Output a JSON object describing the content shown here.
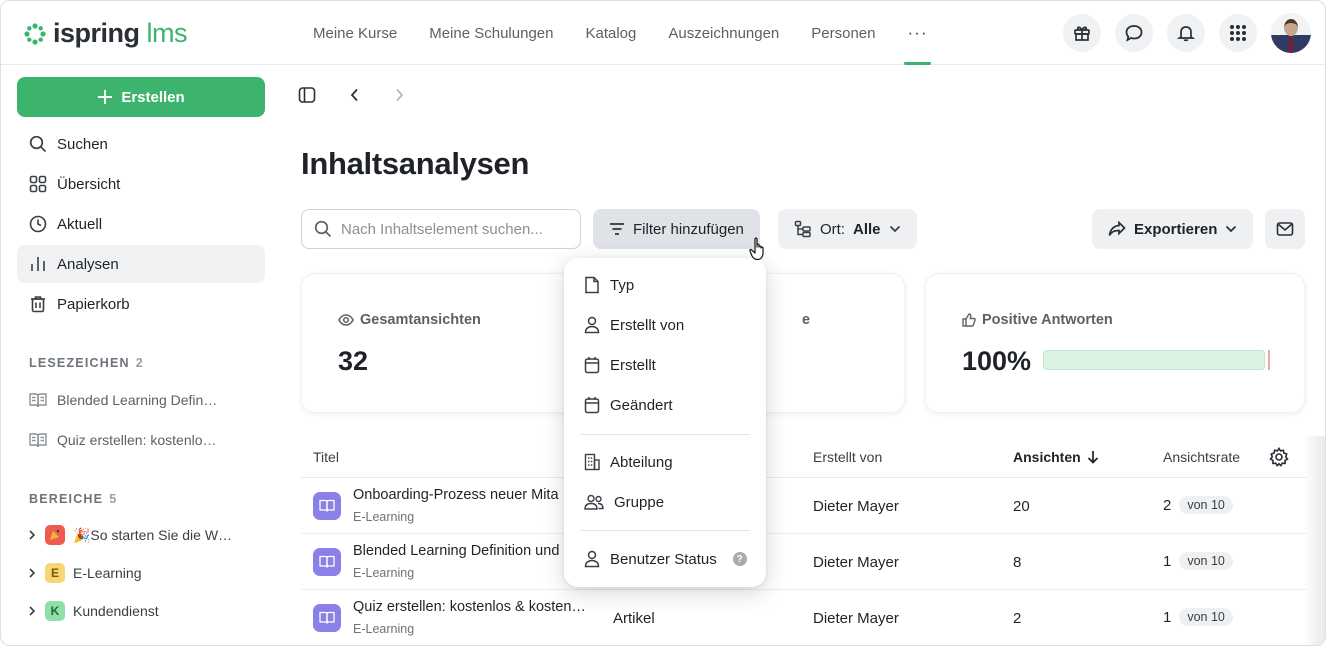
{
  "app": {
    "logo_main": "ispring",
    "logo_sub": "lms",
    "brand_color": "#3db46d"
  },
  "nav": {
    "items": [
      {
        "label": "Meine Kurse"
      },
      {
        "label": "Meine Schulungen"
      },
      {
        "label": "Katalog"
      },
      {
        "label": "Auszeichnungen"
      },
      {
        "label": "Personen"
      }
    ],
    "more": "···"
  },
  "sidebar": {
    "create_label": "Erstellen",
    "items": [
      {
        "label": "Suchen",
        "icon": "search-icon"
      },
      {
        "label": "Übersicht",
        "icon": "grid-icon"
      },
      {
        "label": "Aktuell",
        "icon": "clock-icon"
      },
      {
        "label": "Analysen",
        "icon": "chart-icon",
        "active": true
      },
      {
        "label": "Papierkorb",
        "icon": "trash-icon"
      }
    ],
    "bookmarks_title": "LESEZEICHEN",
    "bookmarks_count": "2",
    "bookmarks": [
      {
        "label": "Blended Learning Defin…"
      },
      {
        "label": "Quiz erstellen: kostenlo…"
      }
    ],
    "areas_title": "BEREICHE",
    "areas_count": "5",
    "areas": [
      {
        "badge": "",
        "label": "🎉So starten Sie die W…",
        "color": "#ef5b4e"
      },
      {
        "badge": "E",
        "label": "E-Learning",
        "color": "#f7d774"
      },
      {
        "badge": "K",
        "label": "Kundendienst",
        "color": "#8fe0a8"
      }
    ]
  },
  "main": {
    "title": "Inhaltsanalysen",
    "search_placeholder": "Nach Inhaltselement suchen...",
    "filter_label": "Filter hinzufügen",
    "location_label": "Ort:",
    "location_value": "Alle",
    "export_label": "Exportieren"
  },
  "cards": [
    {
      "label": "Gesamtansichten",
      "value": "32"
    },
    {
      "label": "e"
    },
    {
      "label": "Positive Antworten",
      "value": "100%",
      "fraction": 1.0
    }
  ],
  "table": {
    "headers": {
      "title": "Titel",
      "created_by": "Erstellt von",
      "views": "Ansichten",
      "view_rate": "Ansichtsrate"
    },
    "rows": [
      {
        "title": "Onboarding-Prozess neuer Mita",
        "type": "E-Learning",
        "kind": "",
        "author": "Dieter Mayer",
        "views": "20",
        "rate": "2",
        "rate_of": "von 10"
      },
      {
        "title": "Blended Learning Definition und",
        "type": "E-Learning",
        "kind": "",
        "author": "Dieter Mayer",
        "views": "8",
        "rate": "1",
        "rate_of": "von 10"
      },
      {
        "title": "Quiz erstellen: kostenlos & kosten…",
        "type": "E-Learning",
        "kind": "Artikel",
        "author": "Dieter Mayer",
        "views": "2",
        "rate": "1",
        "rate_of": "von 10"
      }
    ]
  },
  "dropdown": {
    "items": [
      {
        "label": "Typ",
        "icon": "file-icon"
      },
      {
        "label": "Erstellt von",
        "icon": "user-icon"
      },
      {
        "label": "Erstellt",
        "icon": "calendar-icon"
      },
      {
        "label": "Geändert",
        "icon": "calendar-icon"
      },
      {
        "label": "Abteilung",
        "icon": "building-icon"
      },
      {
        "label": "Gruppe",
        "icon": "group-icon"
      },
      {
        "label": "Benutzer Status",
        "icon": "user-icon",
        "help": "?"
      }
    ]
  }
}
